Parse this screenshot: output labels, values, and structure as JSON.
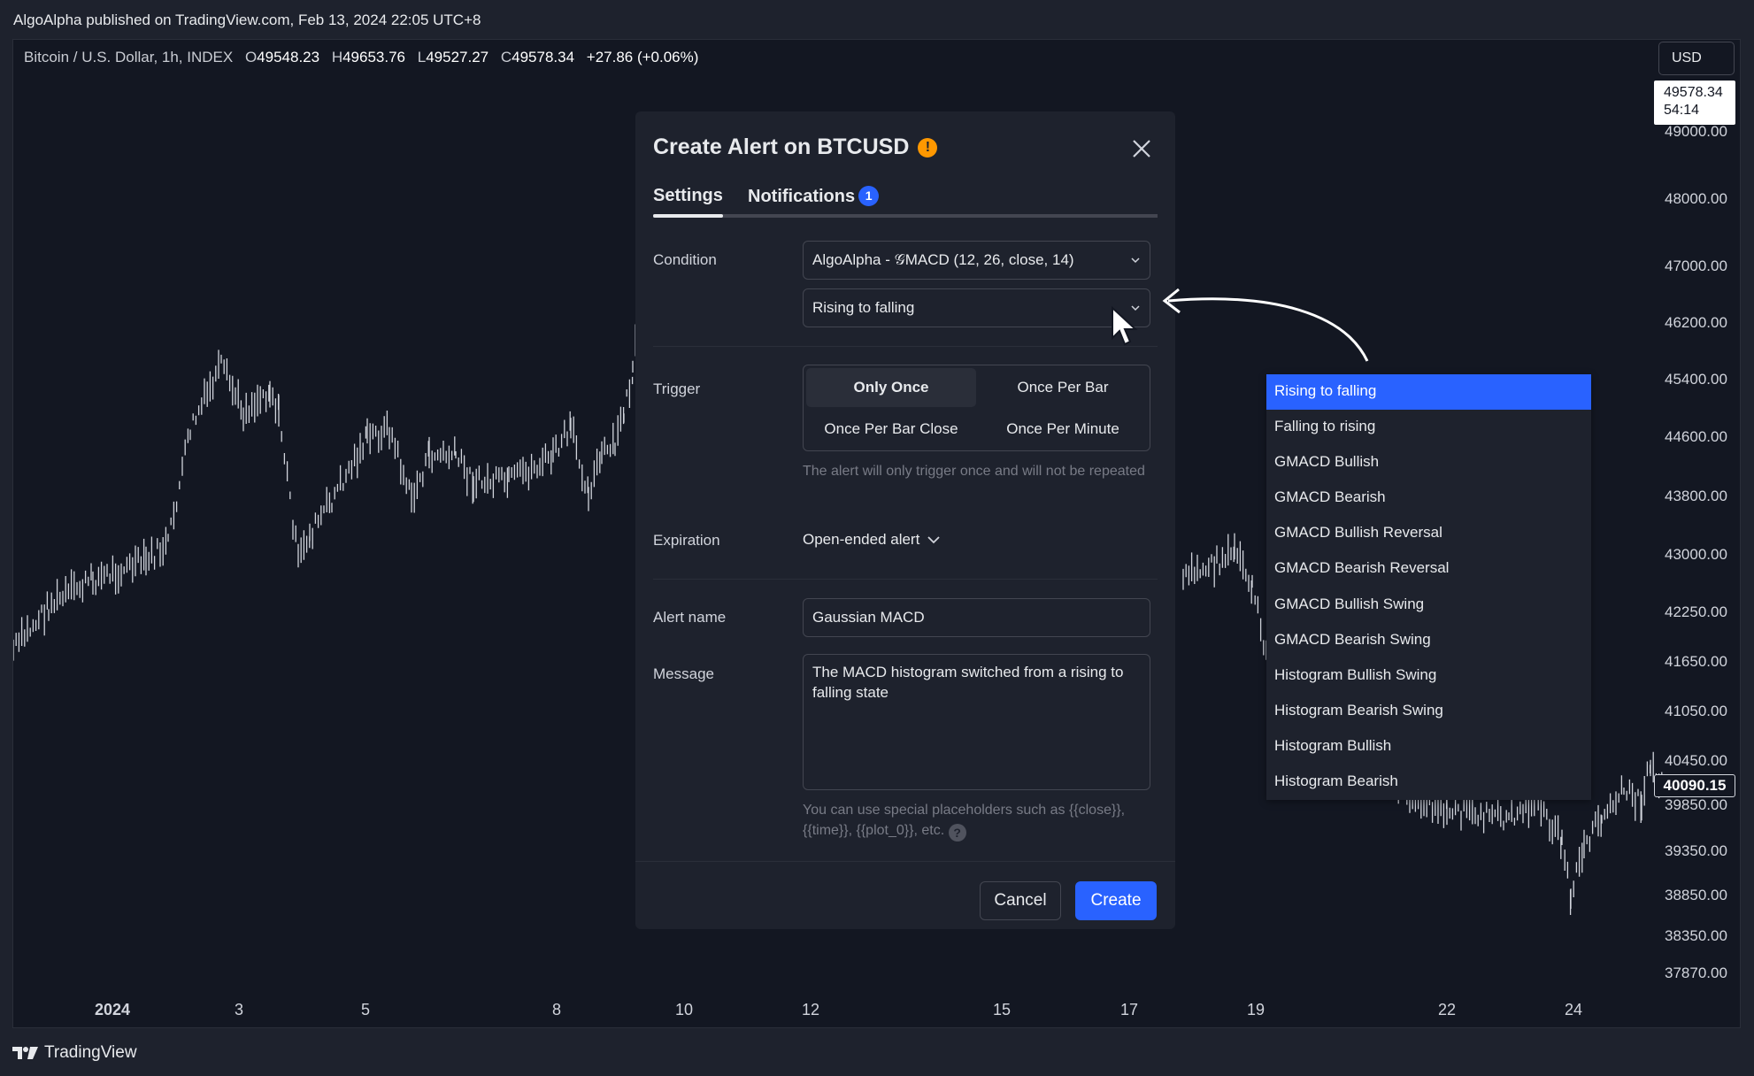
{
  "publish_line": "AlgoAlpha published on TradingView.com, Feb 13, 2024 22:05 UTC+8",
  "legend": {
    "symbol": "Bitcoin / U.S. Dollar, 1h, INDEX",
    "o_label": "O",
    "o_value": "49548.23",
    "h_label": "H",
    "h_value": "49653.76",
    "l_label": "L",
    "l_value": "49527.27",
    "c_label": "C",
    "c_value": "49578.34",
    "change": "+27.86 (+0.06%)"
  },
  "currency_button": "USD",
  "price_tag": {
    "price": "49578.34",
    "countdown": "54:14"
  },
  "current_price_tag": "40090.15",
  "y_axis": [
    "49000.00",
    "48000.00",
    "47000.00",
    "46200.00",
    "45400.00",
    "44600.00",
    "43800.00",
    "43000.00",
    "42250.00",
    "41650.00",
    "41050.00",
    "40450.00",
    "39850.00",
    "39350.00",
    "38850.00",
    "38350.00",
    "37870.00"
  ],
  "x_axis": [
    {
      "label": "2024",
      "bold": true
    },
    {
      "label": "3"
    },
    {
      "label": "5"
    },
    {
      "label": "8"
    },
    {
      "label": "10"
    },
    {
      "label": "12"
    },
    {
      "label": "15"
    },
    {
      "label": "17"
    },
    {
      "label": "19"
    },
    {
      "label": "22"
    },
    {
      "label": "24"
    }
  ],
  "footer_brand": "TradingView",
  "dialog": {
    "title": "Create Alert on BTCUSD",
    "tabs": {
      "settings": "Settings",
      "notifications": "Notifications",
      "notifications_badge": "1"
    },
    "condition": {
      "label": "Condition",
      "indicator": "AlgoAlpha - 𝒢MACD (12, 26, close, 14)",
      "event": "Rising to falling"
    },
    "trigger": {
      "label": "Trigger",
      "options": [
        "Only Once",
        "Once Per Bar",
        "Once Per Bar Close",
        "Once Per Minute"
      ],
      "selected": "Only Once",
      "hint": "The alert will only trigger once and will not be repeated"
    },
    "expiration": {
      "label": "Expiration",
      "value": "Open-ended alert"
    },
    "alert_name": {
      "label": "Alert name",
      "value": "Gaussian MACD"
    },
    "message": {
      "label": "Message",
      "value": "The MACD histogram switched from a rising to falling state",
      "hint": "You can use special placeholders such as {{close}}, {{time}}, {{plot_0}}, etc."
    },
    "buttons": {
      "cancel": "Cancel",
      "create": "Create"
    }
  },
  "condition_dropdown": {
    "options": [
      "Rising to falling",
      "Falling to rising",
      "GMACD Bullish",
      "GMACD Bearish",
      "GMACD Bullish Reversal",
      "GMACD Bearish Reversal",
      "GMACD Bullish Swing",
      "GMACD Bearish Swing",
      "Histogram Bullish Swing",
      "Histogram Bearish Swing",
      "Histogram Bullish",
      "Histogram Bearish"
    ],
    "selected_index": 0
  },
  "colors": {
    "accent": "#2962ff",
    "warning": "#ff9800",
    "background": "#131722",
    "panel": "#1e222d"
  }
}
